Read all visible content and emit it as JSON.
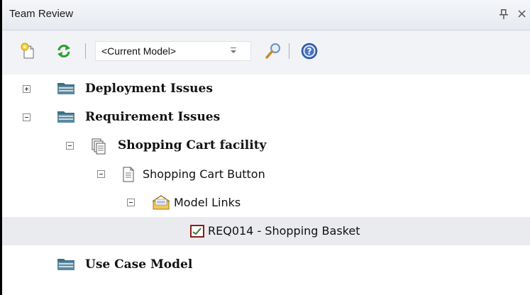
{
  "window": {
    "title": "Team Review",
    "pin_icon": "pin-icon",
    "close_glyph": "×"
  },
  "toolbar": {
    "new_icon": "new-item-icon",
    "refresh_icon": "refresh-icon",
    "scope_value": "<Current Model>",
    "search_icon": "search-icon",
    "help_icon": "help-icon"
  },
  "tree": {
    "items": [
      {
        "label": "Deployment Issues",
        "expanded": false,
        "icon": "folder-icon"
      },
      {
        "label": "Requirement Issues",
        "expanded": true,
        "icon": "folder-icon"
      },
      {
        "label": "Shopping Cart facility",
        "expanded": true,
        "icon": "document-stack-icon"
      },
      {
        "label": "Shopping Cart Button",
        "expanded": true,
        "icon": "document-icon"
      },
      {
        "label": "Model Links",
        "expanded": true,
        "icon": "model-links-icon"
      },
      {
        "label": "REQ014 - Shopping Basket",
        "selected": true,
        "icon": "requirement-icon"
      },
      {
        "label": "Use Case Model",
        "icon": "folder-icon"
      }
    ]
  }
}
